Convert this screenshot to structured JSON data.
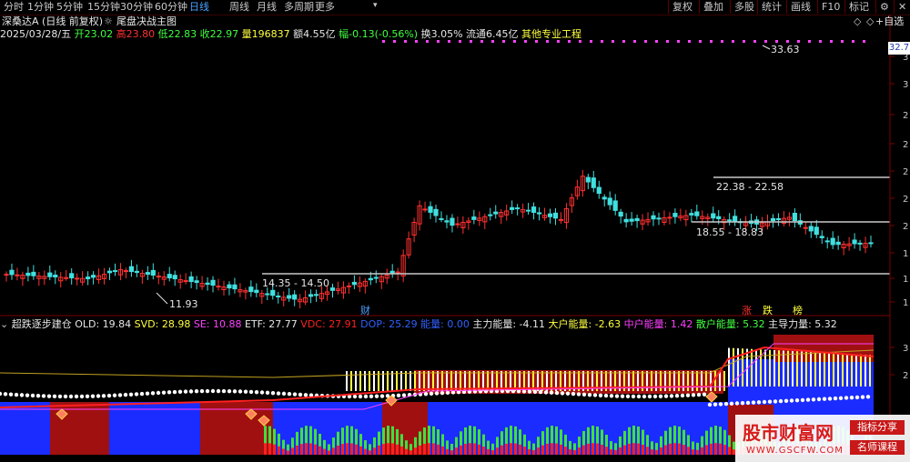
{
  "toolbar": {
    "tabs": [
      "分时",
      "1分钟",
      "5分钟",
      "15分钟",
      "30分钟",
      "60分钟",
      "日线",
      "周线",
      "月线",
      "多周期",
      "更多"
    ],
    "active_tab": "日线",
    "right_buttons": [
      "复权",
      "叠加",
      "多股",
      "统计",
      "画线",
      "F10",
      "标记"
    ],
    "gear_icon": "gear-icon"
  },
  "header": {
    "stock_title": "深桑达A (日线 前复权)",
    "indicator_name": "尾盘决战主图",
    "date": "2025/03/28/五",
    "open_label": "开",
    "open": "23.02",
    "high_label": "高",
    "high": "23.80",
    "low_label": "低",
    "low": "22.83",
    "close_label": "收",
    "close": "22.97",
    "volume_label": "量",
    "volume": "196837",
    "amount_label": "额",
    "amount": "4.55亿",
    "change_label": "幅",
    "change": "-0.13(-0.56%)",
    "turnover_label": "换",
    "turnover": "3.05%",
    "float_label": "流通",
    "float": "6.45亿",
    "sector": "其他专业工程",
    "right_icons": [
      "◇",
      "◇",
      "+自选"
    ],
    "price_tag": "32.7"
  },
  "price_annotations": {
    "high_label": "33.63",
    "low_label": "11.93",
    "zone1": "14.35 - 14.50",
    "zone2": "18.55 - 18.83",
    "zone3": "22.38 - 22.58",
    "marker_cai": "财",
    "marker_zhang": "涨",
    "marker_die": "跌",
    "marker_bang": "榜"
  },
  "main_axis_digits": [
    "3",
    "3",
    "2",
    "2",
    "2",
    "2",
    "2",
    "1",
    "1",
    "1",
    "1"
  ],
  "sub_axis_digits": [
    "3",
    "2"
  ],
  "indicator": {
    "name": "超跌逐步建仓",
    "items": [
      {
        "label": "OLD: 19.84",
        "color": "#e6e6e6"
      },
      {
        "label": "SVD: 28.98",
        "color": "#ffff40"
      },
      {
        "label": "SE: 10.88",
        "color": "#ff40ff"
      },
      {
        "label": "ETF: 27.77",
        "color": "#e6e6e6"
      },
      {
        "label": "VDC: 27.91",
        "color": "#ff2020"
      },
      {
        "label": "DOP: 25.29",
        "color": "#3060ff"
      },
      {
        "label": "能量: 0.00",
        "color": "#3060ff"
      },
      {
        "label": "主力能量: -4.11",
        "color": "#e6e6e6"
      },
      {
        "label": "大户能量: -2.63",
        "color": "#ffff40"
      },
      {
        "label": "中户能量: 1.42",
        "color": "#ff40ff"
      },
      {
        "label": "散户能量: 5.32",
        "color": "#40ff40"
      },
      {
        "label": "主导力量: 5.32",
        "color": "#e6e6e6"
      }
    ]
  },
  "watermark": {
    "brand": "股市财富网",
    "url": "WWW.GSCFW.COM",
    "tag1": "指标分享",
    "tag2": "名师课程"
  },
  "colors": {
    "up": "#ff3030",
    "down": "#40e0e0",
    "zone": "#c8c8c8",
    "accent_blue": "#4aa0ff"
  }
}
